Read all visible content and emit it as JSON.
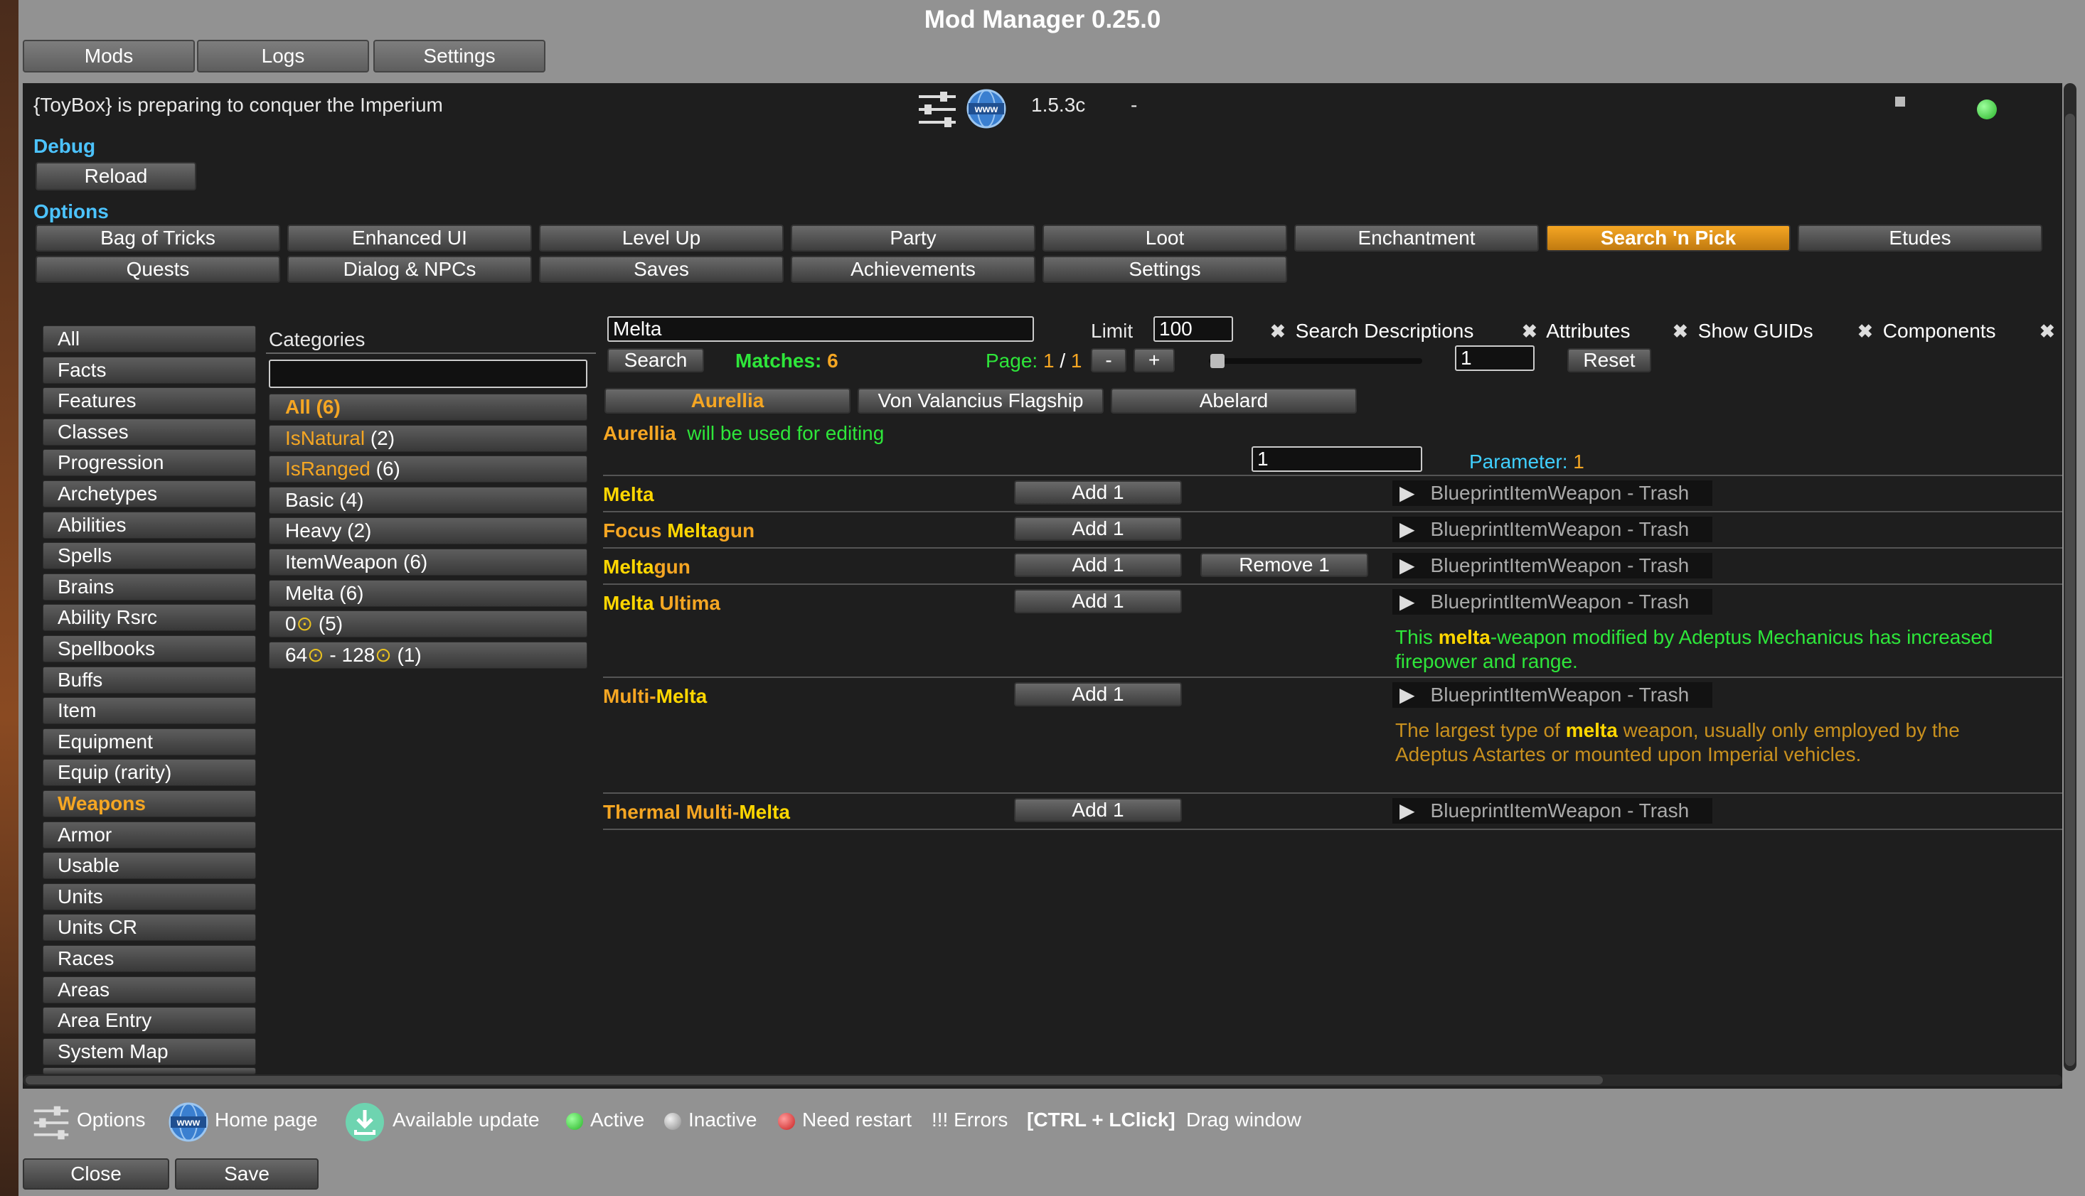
{
  "window": {
    "title": "Mod Manager 0.25.0"
  },
  "top_tabs": [
    "Mods",
    "Logs",
    "Settings"
  ],
  "mod": {
    "description": "{ToyBox} is preparing to conquer the Imperium",
    "version": "1.5.3c",
    "separator": "-",
    "options_icon": "sliders-icon",
    "home_icon": "globe-www-icon"
  },
  "debug": {
    "header": "Debug",
    "reload": "Reload"
  },
  "options": {
    "header": "Options",
    "row1": [
      "Bag of Tricks",
      "Enhanced UI",
      "Level Up",
      "Party",
      "Loot",
      "Enchantment",
      "Search 'n Pick",
      "Etudes"
    ],
    "row2": [
      "Quests",
      "Dialog & NPCs",
      "Saves",
      "Achievements",
      "Settings"
    ],
    "selected": "Search 'n Pick"
  },
  "nav": {
    "items": [
      "All",
      "Facts",
      "Features",
      "Classes",
      "Progression",
      "Archetypes",
      "Abilities",
      "Spells",
      "Brains",
      "Ability Rsrc",
      "Spellbooks",
      "Buffs",
      "Item",
      "Equipment",
      "Equip (rarity)",
      "Weapons",
      "Armor",
      "Usable",
      "Units",
      "Units CR",
      "Races",
      "Areas",
      "Area Entry",
      "System Map"
    ],
    "selected": "Weapons"
  },
  "categories": {
    "header": "Categories",
    "filter_value": "",
    "items": [
      {
        "label": "All (6)",
        "style": "orange-bold"
      },
      {
        "label": "IsNatural",
        "count": " (2)",
        "style": "orange"
      },
      {
        "label": "IsRanged",
        "count": " (6)",
        "style": "orange"
      },
      {
        "label": "Basic (4)",
        "style": "white"
      },
      {
        "label": "Heavy (2)",
        "style": "white"
      },
      {
        "label": "ItemWeapon (6)",
        "style": "white"
      },
      {
        "label": "Melta (6)",
        "style": "white"
      },
      {
        "label": "0",
        "suffix": " (5)",
        "style": "coin"
      },
      {
        "label": "64",
        "mid": " - 128",
        "suffix": " (1)",
        "style": "coin2"
      }
    ]
  },
  "search": {
    "query": "Melta",
    "limit_label": "Limit",
    "limit_value": "100",
    "search_button": "Search",
    "matches_label": "Matches:",
    "matches_value": "6",
    "page_label": "Page:",
    "page_current": "1",
    "page_sep": "/",
    "page_total": "1",
    "minus": "-",
    "plus": "+",
    "slider_value": "1",
    "reset": "Reset",
    "checkboxes": [
      "Search Descriptions",
      "Attributes",
      "Show GUIDs",
      "Components"
    ]
  },
  "party": {
    "members": [
      "Aurellia",
      "Von Valancius Flagship",
      "Abelard"
    ],
    "selected": "Aurellia",
    "editing_name": "Aurellia",
    "editing_text": "will be used for editing",
    "param_value": "1",
    "param_label": "Parameter:",
    "param_num": "1"
  },
  "results": [
    {
      "name_parts": [
        {
          "t": "Melta",
          "c": "yellow"
        }
      ],
      "add": "Add 1",
      "type": "BlueprintItemWeapon - Trash"
    },
    {
      "name_parts": [
        {
          "t": "Focus ",
          "c": "orange"
        },
        {
          "t": "Melta",
          "c": "yellow"
        },
        {
          "t": "gun",
          "c": "orange"
        }
      ],
      "add": "Add 1",
      "type": "BlueprintItemWeapon - Trash"
    },
    {
      "name_parts": [
        {
          "t": "Melta",
          "c": "yellow"
        },
        {
          "t": "gun",
          "c": "orange"
        }
      ],
      "add": "Add 1",
      "remove": "Remove 1",
      "type": "BlueprintItemWeapon - Trash"
    },
    {
      "name_parts": [
        {
          "t": "Melta",
          "c": "yellow"
        },
        {
          "t": " Ultima",
          "c": "orange"
        }
      ],
      "add": "Add 1",
      "type": "BlueprintItemWeapon - Trash",
      "desc_parts": [
        {
          "t": "This ",
          "c": "green"
        },
        {
          "t": "melta",
          "c": "yellow"
        },
        {
          "t": "-weapon modified by Adeptus Mechanicus has increased",
          "c": "green"
        }
      ],
      "desc_line2": "firepower and range."
    },
    {
      "name_parts": [
        {
          "t": "Multi-",
          "c": "orange"
        },
        {
          "t": "Melta",
          "c": "yellow"
        }
      ],
      "add": "Add 1",
      "type": "BlueprintItemWeapon - Trash",
      "desc_parts": [
        {
          "t": "The largest type of ",
          "c": "dorange"
        },
        {
          "t": "melta",
          "c": "yellow"
        },
        {
          "t": " weapon, usually only employed by the",
          "c": "dorange"
        }
      ],
      "desc_line2": "Adeptus Astartes or mounted upon Imperial vehicles."
    },
    {
      "name_parts": [
        {
          "t": "Thermal Multi-",
          "c": "orange"
        },
        {
          "t": "Melta",
          "c": "yellow"
        }
      ],
      "add": "Add 1",
      "type": "BlueprintItemWeapon - Trash"
    }
  ],
  "legend": {
    "options": "Options",
    "home": "Home page",
    "update": "Available update",
    "active": "Active",
    "inactive": "Inactive",
    "restart": "Need restart",
    "errors": "!!! Errors",
    "shortcut": "[CTRL + LClick]",
    "drag": "Drag window"
  },
  "footer": {
    "close": "Close",
    "save": "Save"
  },
  "colors": {
    "accent_orange": "#f5a623",
    "name_yellow": "#ffd700",
    "green": "#2ee63a",
    "header_cyan": "#4cc3ff",
    "desc_orange": "#c8901e"
  }
}
